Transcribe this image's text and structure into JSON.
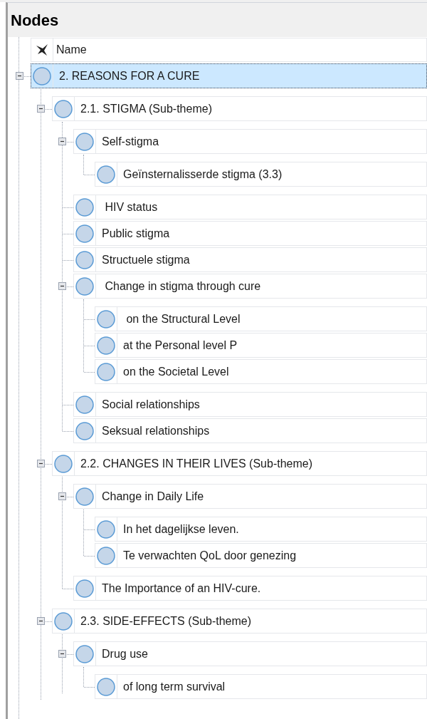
{
  "title": "Nodes",
  "header": {
    "column": "Name"
  },
  "nodes": [
    {
      "label": "2. REASONS FOR A CURE",
      "selected": true,
      "expanded": true,
      "children": [
        {
          "label": "2.1. STIGMA (Sub-theme)",
          "selected": false,
          "expanded": true,
          "children": [
            {
              "label": "Self-stigma",
              "selected": false,
              "expanded": true,
              "children": [
                {
                  "label": "Geïnsternalisserde stigma (3.3)",
                  "selected": false
                }
              ]
            },
            {
              "label": " HIV status",
              "selected": false
            },
            {
              "label": "Public stigma",
              "selected": false
            },
            {
              "label": "Structuele stigma",
              "selected": false
            },
            {
              "label": " Change in stigma through cure",
              "selected": false,
              "expanded": true,
              "children": [
                {
                  "label": " on the Structural Level",
                  "selected": false
                },
                {
                  "label": "at the Personal level P",
                  "selected": false
                },
                {
                  "label": "on the Societal Level",
                  "selected": false
                }
              ]
            },
            {
              "label": "Social relationships",
              "selected": false
            },
            {
              "label": "Seksual relationships",
              "selected": false
            }
          ]
        },
        {
          "label": "2.2. CHANGES IN THEIR LIVES (Sub-theme)",
          "selected": false,
          "expanded": true,
          "children": [
            {
              "label": "Change in Daily Life",
              "selected": false,
              "expanded": true,
              "children": [
                {
                  "label": "In het dagelijkse leven.",
                  "selected": false
                },
                {
                  "label": "Te verwachten QoL door genezing",
                  "selected": false
                }
              ]
            },
            {
              "label": "The Importance of an HIV-cure.",
              "selected": false
            }
          ]
        },
        {
          "label": "2.3. SIDE-EFFECTS (Sub-theme)",
          "selected": false,
          "expanded": true,
          "children": [
            {
              "label": "Drug use",
              "selected": false,
              "expanded": true,
              "children": [
                {
                  "label": "of long term survival",
                  "selected": false
                }
              ]
            }
          ]
        }
      ]
    }
  ]
}
